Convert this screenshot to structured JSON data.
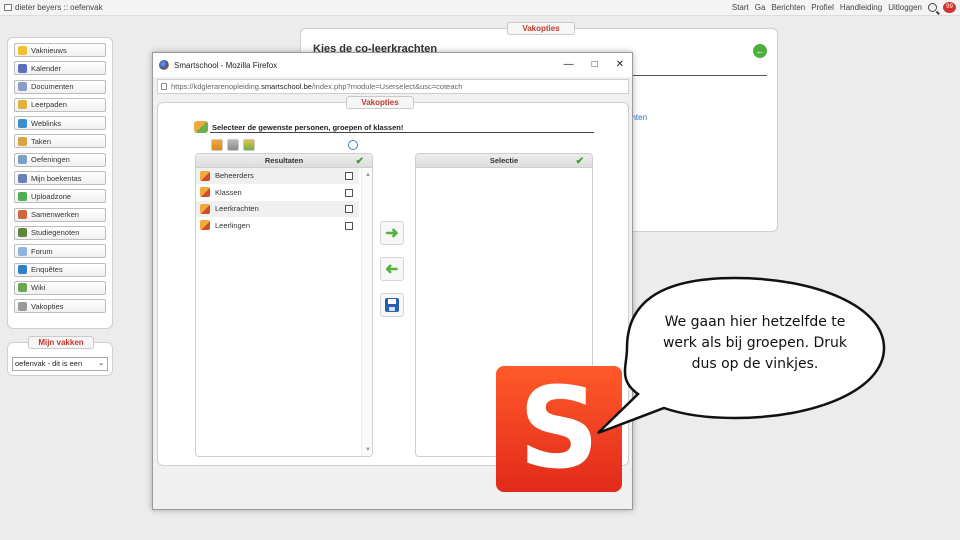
{
  "topbar": {
    "site_title": "dieter beyers :: oefenvak",
    "nav": [
      "Start",
      "Ga",
      "Berichten",
      "Profiel",
      "Handleiding",
      "Uitloggen"
    ],
    "chat_badge": "99"
  },
  "sidebar": {
    "items": [
      {
        "label": "Vaknieuws",
        "icon": "star-icon",
        "color": "#f2c12e"
      },
      {
        "label": "Kalender",
        "icon": "calendar-icon",
        "color": "#5b6fc2"
      },
      {
        "label": "Documenten",
        "icon": "documents-icon",
        "color": "#8a9cc8"
      },
      {
        "label": "Leerpaden",
        "icon": "path-icon",
        "color": "#e2b23a"
      },
      {
        "label": "Weblinks",
        "icon": "globe-icon",
        "color": "#3a8fd0"
      },
      {
        "label": "Taken",
        "icon": "tasks-icon",
        "color": "#d9a441"
      },
      {
        "label": "Oefeningen",
        "icon": "exercises-icon",
        "color": "#7aa0c8"
      },
      {
        "label": "Mijn boekentas",
        "icon": "backpack-icon",
        "color": "#6a7fb8"
      },
      {
        "label": "Uploadzone",
        "icon": "upload-icon",
        "color": "#4caf50"
      },
      {
        "label": "Samenwerken",
        "icon": "collaborate-icon",
        "color": "#d0673c"
      },
      {
        "label": "Studiegenoten",
        "icon": "classmates-icon",
        "color": "#5d8a3a"
      },
      {
        "label": "Forum",
        "icon": "forum-icon",
        "color": "#8fb4e0"
      },
      {
        "label": "Enquêtes",
        "icon": "survey-icon",
        "color": "#2f7fc9"
      },
      {
        "label": "Wiki",
        "icon": "wiki-icon",
        "color": "#6aa84f"
      },
      {
        "label": "Vakopties",
        "icon": "wrench-icon",
        "color": "#9a9a9a"
      }
    ],
    "my_courses_tab": "Mijn vakken",
    "course_select": "oefenvak - dit is een"
  },
  "background_panel": {
    "tab": "Vakopties",
    "title": "Kies de co-leerkrachten",
    "link_fragment": "achten"
  },
  "popup": {
    "window_title": "Smartschool - Mozilla Firefox",
    "url_prefix": "https://kdglerarenopleiding.",
    "url_domain": "smartschool.be",
    "url_path": "/index.php?module=Userselect&usc=coteach",
    "tab": "Vakopties",
    "heading": "Selecteer de gewenste personen, groepen of klassen!",
    "results_header": "Resultaten",
    "selection_header": "Selectie",
    "results": [
      "Beheerders",
      "Klassen",
      "Leerkrachten",
      "Leerlingen"
    ]
  },
  "logo": {
    "letter": "S"
  },
  "speech_bubble": {
    "text": "We gaan hier hetzelfde te werk als bij groepen. Druk dus op de vinkjes."
  }
}
